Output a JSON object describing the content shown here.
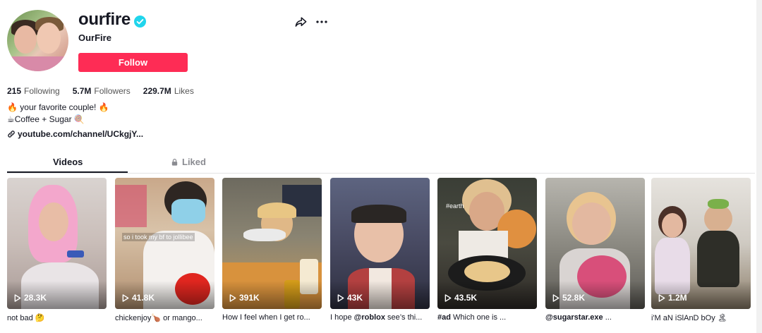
{
  "profile": {
    "username": "ourfire",
    "nickname": "OurFire",
    "follow_label": "Follow",
    "stats": [
      {
        "value": "215",
        "label": "Following"
      },
      {
        "value": "5.7M",
        "label": "Followers"
      },
      {
        "value": "229.7M",
        "label": "Likes"
      }
    ],
    "bio_line1": "🔥 your favorite couple! 🔥",
    "bio_line2": "☕Coffee + Sugar 🍭",
    "link": "youtube.com/channel/UCkgjY..."
  },
  "tabs": {
    "videos": "Videos",
    "liked": "Liked"
  },
  "icons": {
    "verified": "verified-badge-icon",
    "share": "share-arrow-icon",
    "more": "more-dots-icon",
    "link": "link-chain-icon",
    "lock": "lock-icon",
    "play": "play-outline-icon"
  },
  "colors": {
    "accent": "#fe2c55",
    "verified": "#20d5ec"
  },
  "videos": [
    {
      "views": "28.3K",
      "caption": "not bad 🤔",
      "overlay": ""
    },
    {
      "views": "41.8K",
      "caption": "chickenjoy🍗 or mango...",
      "overlay": "so i took my bf to jollibee"
    },
    {
      "views": "391K",
      "caption": "How I feel when I get ro...",
      "overlay": ""
    },
    {
      "views": "43K",
      "caption_pre": "I hope ",
      "caption_bold": "@roblox",
      "caption_post": " see’s thi...",
      "overlay": ""
    },
    {
      "views": "43.5K",
      "caption_pre": "",
      "caption_bold": "#ad",
      "caption_post": " Which one is ...",
      "overlay": "#earth"
    },
    {
      "views": "52.8K",
      "caption_pre": "",
      "caption_bold": "@sugarstar.exe",
      "caption_post": " ...",
      "overlay": ""
    },
    {
      "views": "1.2M",
      "caption": "i'M aN iSlAnD bOy 🏝",
      "overlay": ""
    }
  ]
}
